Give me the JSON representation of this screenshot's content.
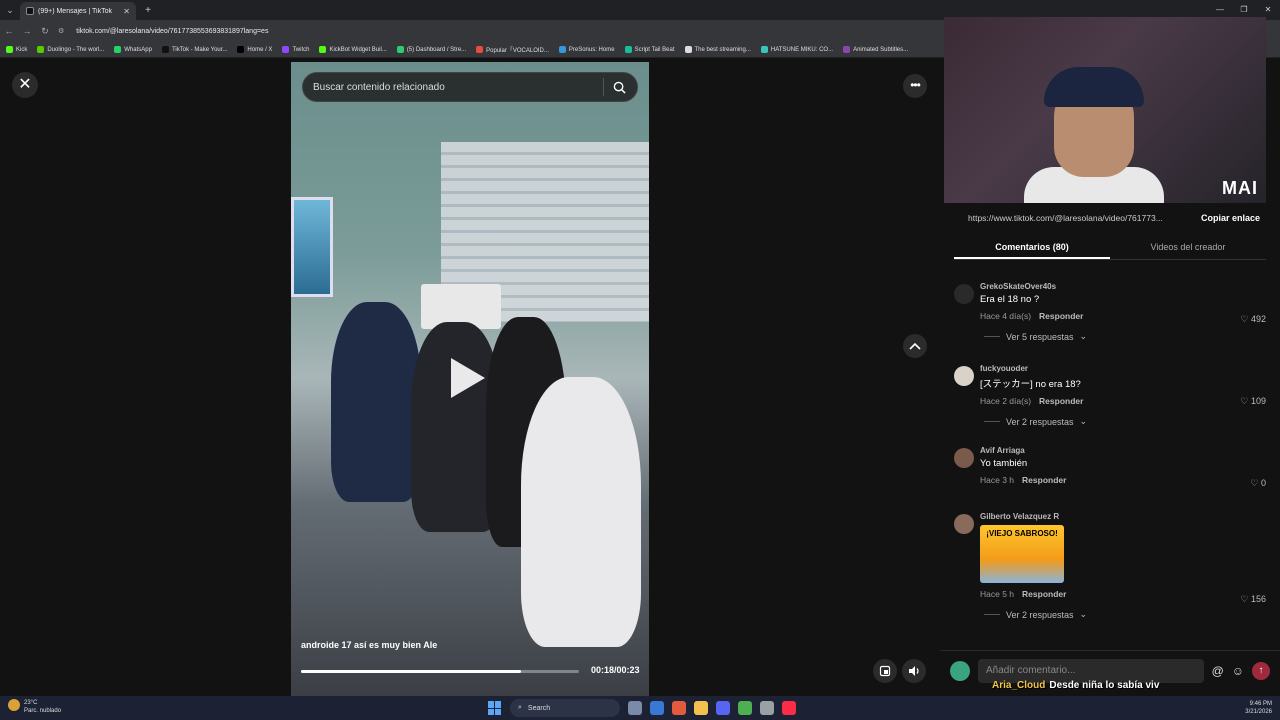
{
  "browser": {
    "tab_title": "(99+) Mensajes | TikTok",
    "url": "tiktok.com/@laresolana/video/7617738553693831897lang=es",
    "bookmarks": [
      {
        "label": "Kick",
        "color": "#53fc18"
      },
      {
        "label": "Duolingo - The worl...",
        "color": "#58cc02"
      },
      {
        "label": "WhatsApp",
        "color": "#25d366"
      },
      {
        "label": "TikTok - Make Your...",
        "color": "#111111"
      },
      {
        "label": "Home / X",
        "color": "#000000"
      },
      {
        "label": "Twitch",
        "color": "#9146ff"
      },
      {
        "label": "KickBot Widget Buil...",
        "color": "#53fc18"
      },
      {
        "label": "(5) Dashboard / Stre...",
        "color": "#2ecc71"
      },
      {
        "label": "Popular「VOCALOID...",
        "color": "#e74c3c"
      },
      {
        "label": "PreSonus: Home",
        "color": "#3498db"
      },
      {
        "label": "Script Tail Beat",
        "color": "#1abc9c"
      },
      {
        "label": "The best streaming...",
        "color": "#dddddd"
      },
      {
        "label": "HATSUNE MIKU: CO...",
        "color": "#39c5bb"
      },
      {
        "label": "Animated Subtitles...",
        "color": "#8e44ad"
      }
    ]
  },
  "video": {
    "search_placeholder": "Buscar contenido relacionado",
    "caption": "androide 17 así es muy bien Ale",
    "time": "00:18/00:23",
    "progress": 0.79
  },
  "panel": {
    "link_url": "https://www.tiktok.com/@laresolana/video/761773...",
    "copy_label": "Copiar enlace",
    "webcam_logo": "MAI",
    "tabs": [
      {
        "label": "Comentarios (80)",
        "active": true
      },
      {
        "label": "Videos del creador",
        "active": false
      }
    ],
    "comments": [
      {
        "user": "GrekoSkateOver40s",
        "text": "Era el 18 no ?",
        "time": "Hace 4 día(s)",
        "reply": "Responder",
        "likes": "492",
        "replies": "Ver 5 respuestas",
        "avatar": "#2a2a2a"
      },
      {
        "user": "fuckyouoder",
        "text": "[ステッカー] no era 18?",
        "time": "Hace 2 día(s)",
        "reply": "Responder",
        "likes": "109",
        "replies": "Ver 2 respuestas",
        "avatar": "#d8d2c8"
      },
      {
        "user": "Avif Arriaga",
        "text": "Yo también",
        "time": "Hace 3 h",
        "reply": "Responder",
        "likes": "0",
        "replies": "",
        "avatar": "#7a5a4a"
      },
      {
        "user": "Gilberto Velazquez R",
        "text": "",
        "sticker": "¡VIEJO SABROSO!",
        "time": "Hace 5 h",
        "reply": "Responder",
        "likes": "156",
        "replies": "Ver 2 respuestas",
        "avatar": "#8a6a5a"
      }
    ],
    "add_comment_placeholder": "Añadir comentario...",
    "chat_user": "Aria_Cloud",
    "chat_message": "Desde niña lo sabía viv"
  },
  "taskbar": {
    "temp": "23°C",
    "weather": "Parc. nublado",
    "search_label": "Search",
    "time": "9:46 PM",
    "date": "3/21/2026"
  }
}
